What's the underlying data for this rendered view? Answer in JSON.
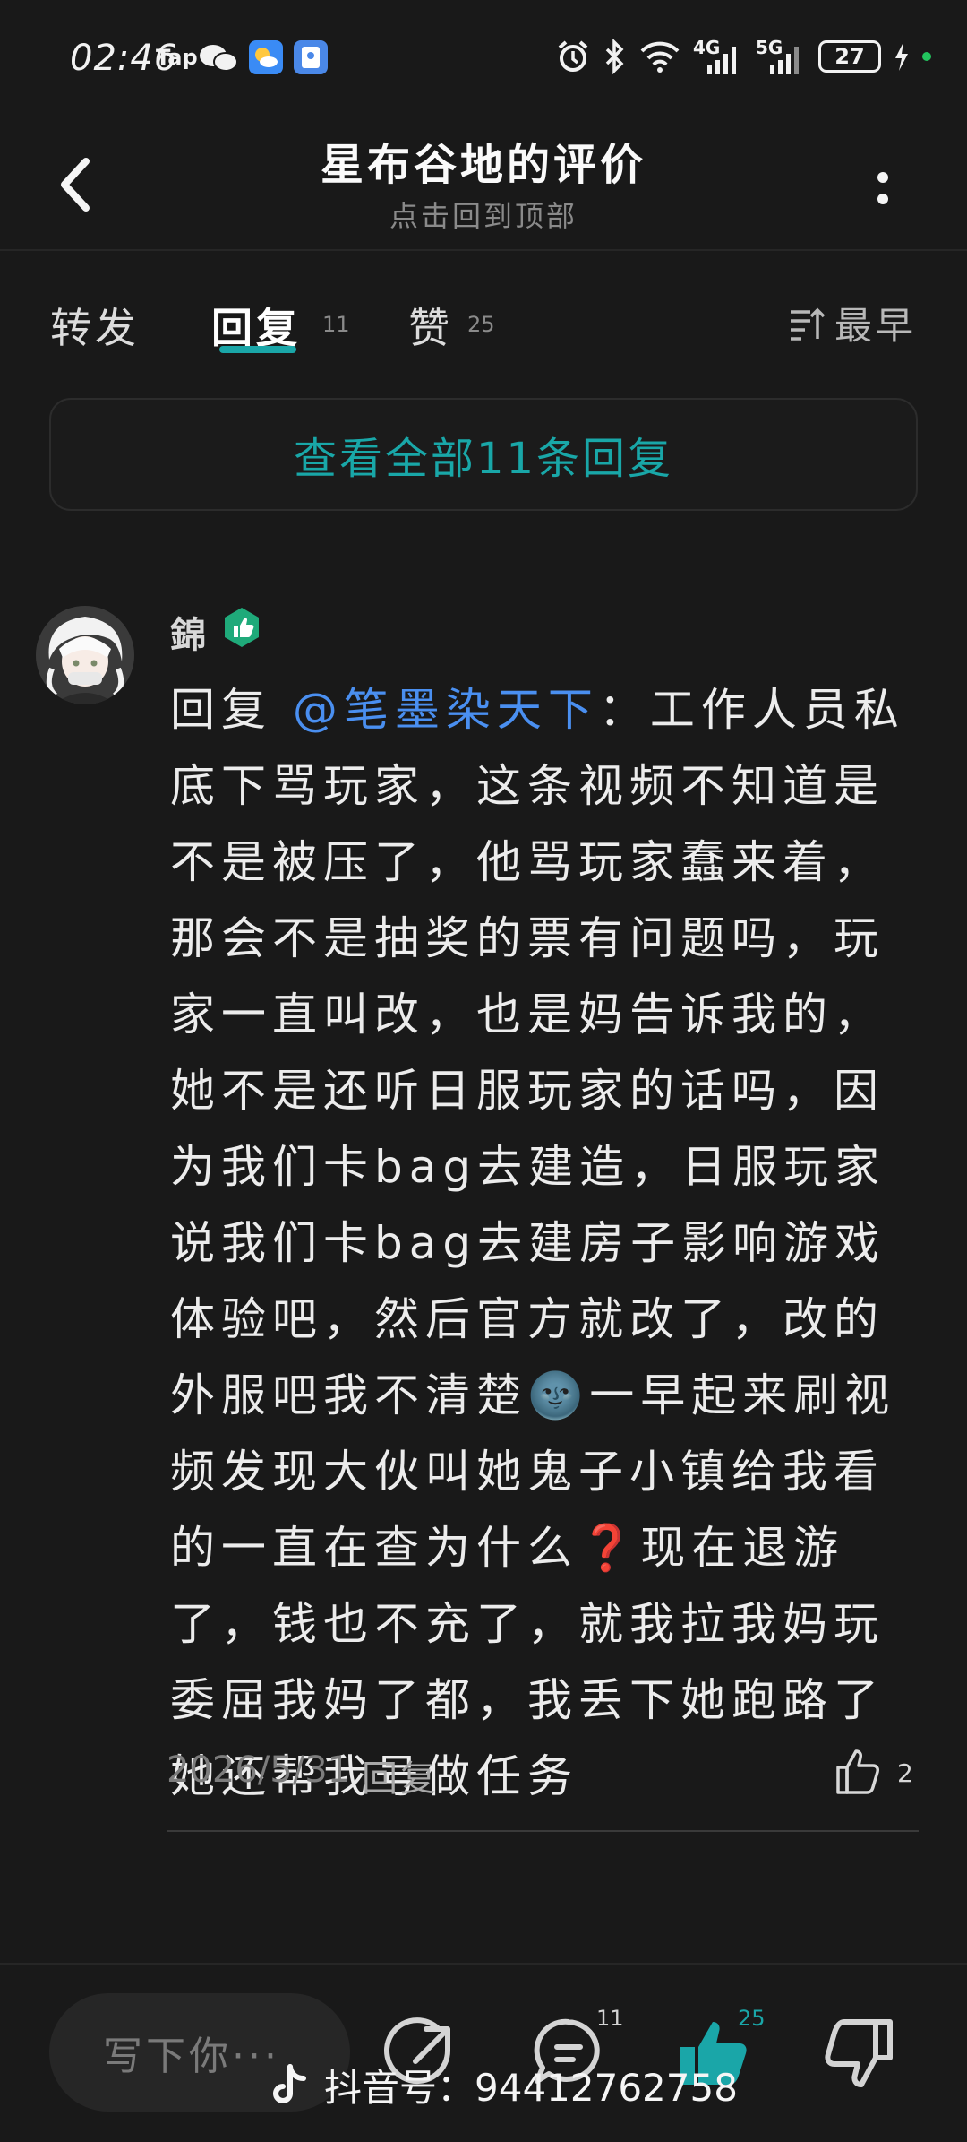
{
  "status_bar": {
    "time": "02:46",
    "tap": "Tap",
    "net_4g": "4G",
    "net_5g": "5G",
    "battery": "27"
  },
  "header": {
    "title": "星布谷地的评价",
    "subtitle": "点击回到顶部"
  },
  "tabs": {
    "forward": "转发",
    "reply": "回复",
    "reply_count": "11",
    "like": "赞",
    "like_count": "25",
    "sort": "最早"
  },
  "view_all_label": "查看全部11条回复",
  "comment": {
    "username": "錦",
    "reply_prefix": "回复 ",
    "mention": "@笔墨染天下",
    "text_part1": "：工作人员私底下骂玩家，这条视频不知道是不是被压了，他骂玩家蠢来着，那会不是抽奖的票有问题吗，玩家一直叫改，也是妈告诉我的，她不是还听日服玩家的话吗，因为我们卡bag去建造，日服玩家说我们卡bag去建房子影响游戏体验吧，然后官方就改了，改的外服吧我不清楚",
    "emoji_moon": "🌚",
    "text_part2": "一早起来刷视频发现大伙叫她鬼子小镇给我看的一直在查为什么",
    "emoji_question": "❓",
    "text_part3": "现在退游了，钱也不充了，就我拉我妈玩委屈我妈了都，我丢下她跑路了她还帮我号做任务",
    "date": "2026/5/31",
    "reply_label": "回复",
    "like_count": "2"
  },
  "bottom_bar": {
    "composer_placeholder": "写下你···",
    "comment_count": "11",
    "like_count": "25",
    "watermark": "抖音号：94412762758"
  },
  "colors": {
    "accent": "#1aa6a8",
    "mention": "#4a8ff0",
    "background": "#191919"
  }
}
